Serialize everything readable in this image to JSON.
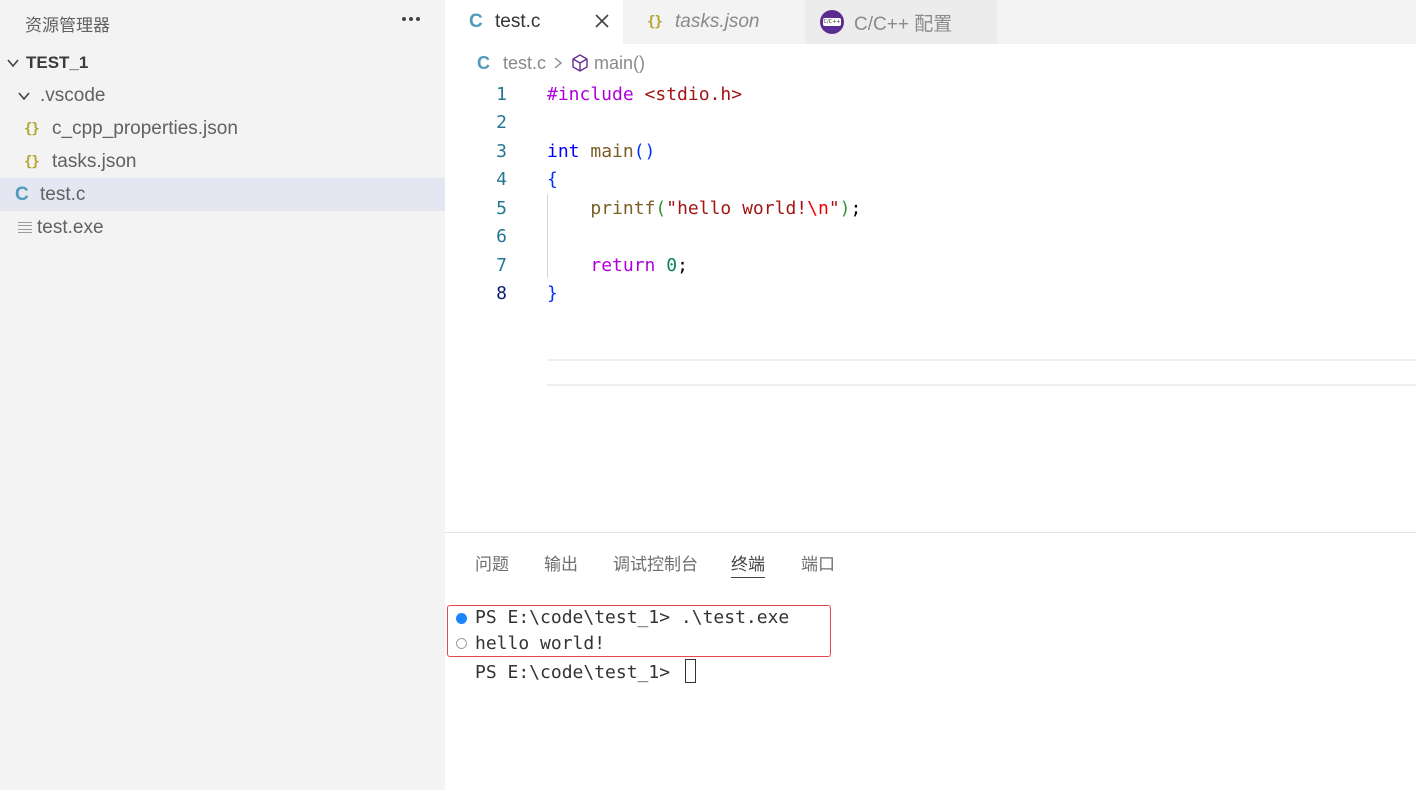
{
  "sidebar": {
    "title": "资源管理器",
    "more_icon": "ellipsis-icon",
    "root": {
      "label": "TEST_1",
      "expanded": true
    },
    "items": [
      {
        "label": ".vscode",
        "kind": "folder",
        "expanded": true,
        "icon": "chevron-down-icon"
      },
      {
        "label": "c_cpp_properties.json",
        "kind": "json",
        "icon": "json-braces-icon",
        "icon_text": "{}"
      },
      {
        "label": "tasks.json",
        "kind": "json",
        "icon": "json-braces-icon",
        "icon_text": "{}"
      },
      {
        "label": "test.c",
        "kind": "c",
        "icon": "c-file-icon",
        "icon_text": "C",
        "selected": true
      },
      {
        "label": "test.exe",
        "kind": "binary",
        "icon": "lines-file-icon"
      }
    ]
  },
  "tabs": [
    {
      "label": "test.c",
      "icon_text": "C",
      "active": true
    },
    {
      "label": "tasks.json",
      "icon_text": "{}",
      "active": false
    },
    {
      "label": "C/C++ 配置",
      "icon_text": "C/C++",
      "active": false
    }
  ],
  "breadcrumb": {
    "file": "test.c",
    "file_icon": "C",
    "symbol": "main()"
  },
  "editor": {
    "current_line": 8,
    "lines": [
      {
        "n": "1",
        "tokens": [
          {
            "t": "#include ",
            "c": "ctl"
          },
          {
            "t": "<stdio.h>",
            "c": "inc"
          }
        ]
      },
      {
        "n": "2",
        "tokens": []
      },
      {
        "n": "3",
        "tokens": [
          {
            "t": "int",
            "c": "kw"
          },
          {
            "t": " ",
            "c": ""
          },
          {
            "t": "main",
            "c": "fn"
          },
          {
            "t": "()",
            "c": "br1"
          }
        ]
      },
      {
        "n": "4",
        "tokens": [
          {
            "t": "{",
            "c": "br1"
          }
        ]
      },
      {
        "n": "5",
        "tokens": [
          {
            "t": "    ",
            "c": ""
          },
          {
            "t": "printf",
            "c": "fn"
          },
          {
            "t": "(",
            "c": "br2"
          },
          {
            "t": "\"hello world!",
            "c": "str"
          },
          {
            "t": "\\n",
            "c": "esc"
          },
          {
            "t": "\"",
            "c": "str"
          },
          {
            "t": ")",
            "c": "br2"
          },
          {
            "t": ";",
            "c": ""
          }
        ]
      },
      {
        "n": "6",
        "tokens": []
      },
      {
        "n": "7",
        "tokens": [
          {
            "t": "    ",
            "c": ""
          },
          {
            "t": "return",
            "c": "ctl"
          },
          {
            "t": " ",
            "c": ""
          },
          {
            "t": "0",
            "c": "num"
          },
          {
            "t": ";",
            "c": ""
          }
        ]
      },
      {
        "n": "8",
        "tokens": [
          {
            "t": "}",
            "c": "br1"
          }
        ]
      }
    ]
  },
  "panel": {
    "tabs": [
      {
        "label": "问题",
        "active": false
      },
      {
        "label": "输出",
        "active": false
      },
      {
        "label": "调试控制台",
        "active": false
      },
      {
        "label": "终端",
        "active": true
      },
      {
        "label": "端口",
        "active": false
      }
    ],
    "terminal": [
      {
        "text": "PS E:\\code\\test_1> .\\test.exe",
        "marker": "filled"
      },
      {
        "text": "hello world!",
        "marker": "hollow"
      },
      {
        "text": "PS E:\\code\\test_1> ",
        "marker": "none",
        "cursor": true
      }
    ]
  },
  "colors": {
    "sidebar_bg": "#f3f3f3",
    "selected_row": "#e4e6f1",
    "json_icon": "#b5a52b",
    "c_icon": "#519aba",
    "highlight_border": "#e5484d",
    "terminal_dot": "#1a85ff"
  }
}
